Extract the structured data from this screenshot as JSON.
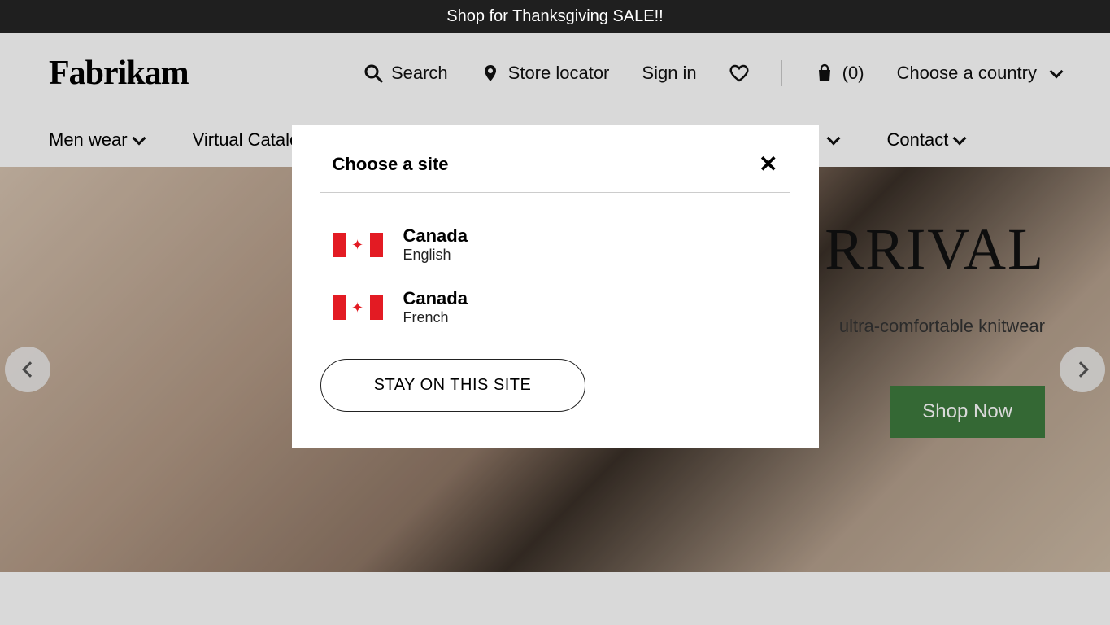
{
  "promoBar": {
    "text": "Shop for Thanksgiving SALE!!"
  },
  "header": {
    "logo": "Fabrikam",
    "search": "Search",
    "storeLocator": "Store locator",
    "signIn": "Sign in",
    "cartCount": "(0)",
    "countryChooser": "Choose a country"
  },
  "nav": {
    "menWear": "Men wear",
    "virtualCatalog": "Virtual Catalog",
    "contact": "Contact"
  },
  "hero": {
    "titleVisible": "RRIVAL",
    "subtitleVisible": "ultra-comfortable knitwear",
    "shopNow": "Shop Now"
  },
  "modal": {
    "title": "Choose a site",
    "options": [
      {
        "country": "Canada",
        "language": "English",
        "flag": "canada"
      },
      {
        "country": "Canada",
        "language": "French",
        "flag": "canada"
      }
    ],
    "stayButton": "STAY ON THIS SITE"
  }
}
